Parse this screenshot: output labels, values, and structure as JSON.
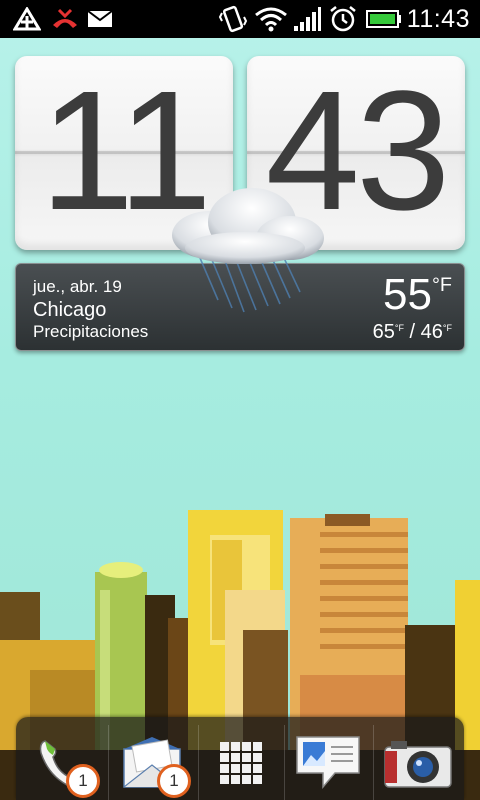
{
  "status_bar": {
    "time": "11:43",
    "icons": [
      "app-alert-icon",
      "missed-call-icon",
      "mail-icon",
      "vibrate-icon",
      "wifi-icon",
      "signal-icon",
      "alarm-icon",
      "battery-icon"
    ],
    "battery_color": "#35c93a"
  },
  "clock": {
    "hour": "11",
    "minute": "43"
  },
  "weather": {
    "date": "jue., abr. 19",
    "city": "Chicago",
    "condition": "Precipitaciones",
    "temp": "55",
    "temp_unit": "°F",
    "high": "65",
    "high_unit": "°F",
    "range_sep": " / ",
    "low": "46",
    "low_unit": "°F"
  },
  "dock": {
    "items": [
      {
        "name": "phone-app",
        "icon": "phone-icon",
        "badge": "1"
      },
      {
        "name": "mail-app",
        "icon": "envelope-icon",
        "badge": "1"
      },
      {
        "name": "all-apps",
        "icon": "grid-icon"
      },
      {
        "name": "messages-app",
        "icon": "message-icon"
      },
      {
        "name": "camera-app",
        "icon": "camera-icon"
      }
    ],
    "badge_color": "#e0611f"
  }
}
